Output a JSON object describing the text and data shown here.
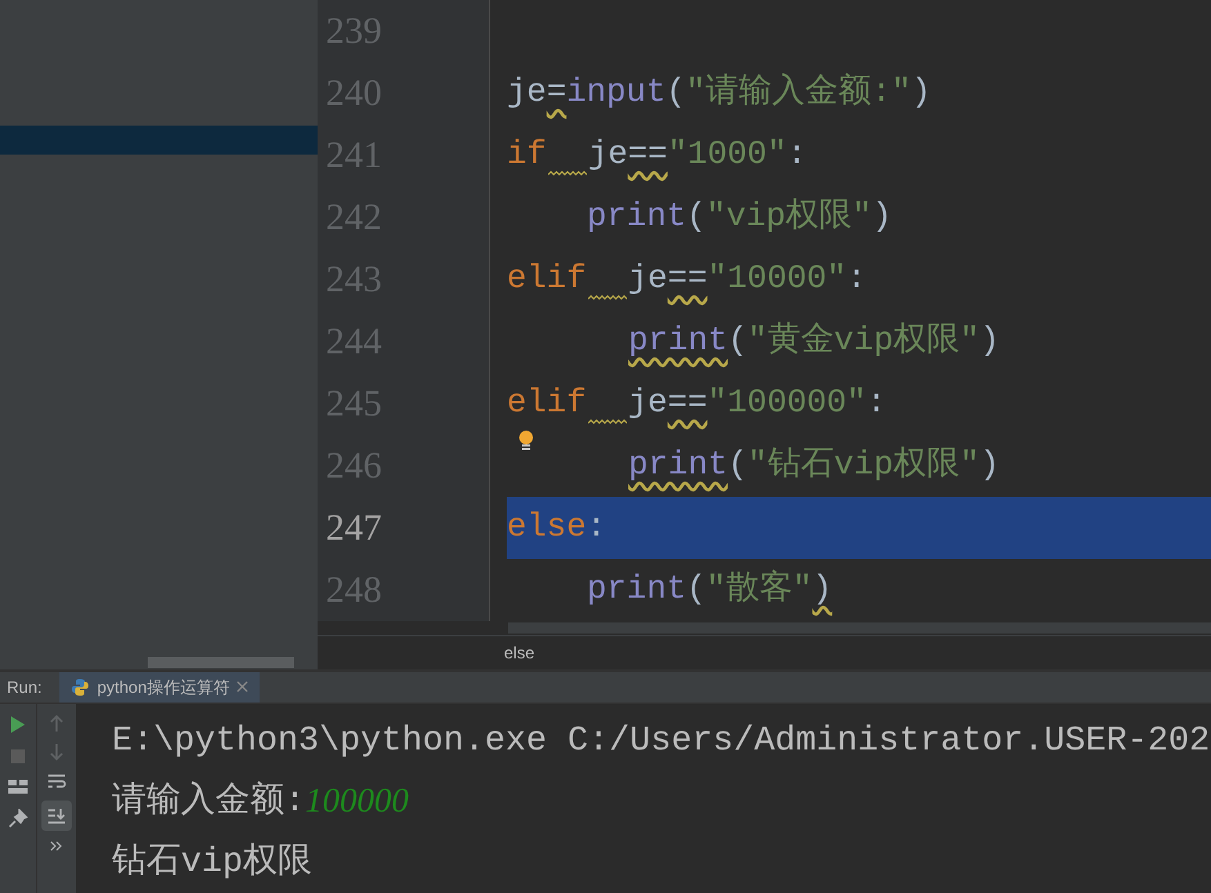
{
  "editor": {
    "lines": [
      {
        "number": "239",
        "kind": "statement",
        "selected": false,
        "bulb": false
      },
      {
        "number": "240",
        "kind": "statement",
        "selected": false,
        "bulb": false,
        "tokens": [
          {
            "kind": "plain",
            "text": "je",
            "warn": false,
            "gap_warn": false
          },
          {
            "kind": "plain",
            "text": "=",
            "warn": true,
            "gap_warn": false
          },
          {
            "kind": "builtin",
            "text": "input",
            "warn": false,
            "gap_warn": false
          },
          {
            "kind": "plain",
            "text": "(",
            "warn": false,
            "gap_warn": false
          },
          {
            "kind": "string",
            "text": "\"请输入金额:\"",
            "warn": false,
            "gap_warn": false
          },
          {
            "kind": "plain",
            "text": ")",
            "warn": false,
            "gap_warn": false
          }
        ]
      },
      {
        "number": "241",
        "kind": "statement",
        "selected": false,
        "bulb": false,
        "tokens": [
          {
            "kind": "keyword",
            "text": "if",
            "warn": false,
            "gap_warn": true
          },
          {
            "kind": "plain",
            "text": "je",
            "warn": false,
            "gap_warn": false
          },
          {
            "kind": "plain",
            "text": "==",
            "warn": true,
            "gap_warn": false
          },
          {
            "kind": "string",
            "text": "\"1000\"",
            "warn": false,
            "gap_warn": false
          },
          {
            "kind": "plain",
            "text": ":",
            "warn": false,
            "gap_warn": false
          }
        ]
      },
      {
        "number": "242",
        "kind": "block",
        "selected": false,
        "bulb": false,
        "tokens": [
          {
            "kind": "builtin",
            "text": "print",
            "warn": false,
            "gap_warn": false
          },
          {
            "kind": "plain",
            "text": "(",
            "warn": false,
            "gap_warn": false
          },
          {
            "kind": "string",
            "text": "\"vip权限\"",
            "warn": false,
            "gap_warn": false
          },
          {
            "kind": "plain",
            "text": ")",
            "warn": false,
            "gap_warn": false
          }
        ]
      },
      {
        "number": "243",
        "kind": "statement",
        "selected": false,
        "bulb": false,
        "tokens": [
          {
            "kind": "keyword",
            "text": "elif",
            "warn": false,
            "gap_warn": true
          },
          {
            "kind": "plain",
            "text": "je",
            "warn": false,
            "gap_warn": false
          },
          {
            "kind": "plain",
            "text": "==",
            "warn": true,
            "gap_warn": false
          },
          {
            "kind": "string",
            "text": "\"10000\"",
            "warn": false,
            "gap_warn": false
          },
          {
            "kind": "plain",
            "text": ":",
            "warn": false,
            "gap_warn": false
          }
        ]
      },
      {
        "number": "244",
        "kind": "deep-block",
        "selected": false,
        "bulb": false,
        "tokens": [
          {
            "kind": "builtin",
            "text": "print",
            "warn": true,
            "gap_warn": false
          },
          {
            "kind": "plain",
            "text": "(",
            "warn": false,
            "gap_warn": false
          },
          {
            "kind": "string",
            "text": "\"黄金vip权限\"",
            "warn": false,
            "gap_warn": false
          },
          {
            "kind": "plain",
            "text": ")",
            "warn": false,
            "gap_warn": false
          }
        ]
      },
      {
        "number": "245",
        "kind": "statement",
        "selected": false,
        "bulb": false,
        "tokens": [
          {
            "kind": "keyword",
            "text": "elif",
            "warn": false,
            "gap_warn": true
          },
          {
            "kind": "plain",
            "text": "je",
            "warn": false,
            "gap_warn": false
          },
          {
            "kind": "plain",
            "text": "==",
            "warn": true,
            "gap_warn": false
          },
          {
            "kind": "string",
            "text": "\"100000\"",
            "warn": false,
            "gap_warn": false
          },
          {
            "kind": "plain",
            "text": ":",
            "warn": false,
            "gap_warn": false
          }
        ]
      },
      {
        "number": "246",
        "kind": "deep-block",
        "selected": false,
        "bulb": true,
        "tokens": [
          {
            "kind": "builtin",
            "text": "print",
            "warn": true,
            "gap_warn": false
          },
          {
            "kind": "plain",
            "text": "(",
            "warn": false,
            "gap_warn": false
          },
          {
            "kind": "string",
            "text": "\"钻石vip权限\"",
            "warn": false,
            "gap_warn": false
          },
          {
            "kind": "plain",
            "text": ")",
            "warn": false,
            "gap_warn": false
          }
        ]
      },
      {
        "number": "247",
        "kind": "statement",
        "selected": true,
        "bulb": false,
        "tokens": [
          {
            "kind": "keyword",
            "text": "else",
            "warn": false,
            "gap_warn": false
          },
          {
            "kind": "plain",
            "text": ":",
            "warn": false,
            "gap_warn": false
          }
        ]
      },
      {
        "number": "248",
        "kind": "block",
        "selected": false,
        "bulb": false,
        "tokens": [
          {
            "kind": "builtin",
            "text": "print",
            "warn": false,
            "gap_warn": false
          },
          {
            "kind": "plain",
            "text": "(",
            "warn": false,
            "gap_warn": false
          },
          {
            "kind": "string",
            "text": "\"散客\"",
            "warn": false,
            "gap_warn": false
          },
          {
            "kind": "plain",
            "text": ")",
            "warn": true,
            "gap_warn": false
          }
        ]
      }
    ],
    "breadcrumb": "else"
  },
  "run": {
    "label": "Run:",
    "tab": "python操作运算符",
    "console": [
      {
        "kind": "output",
        "text": "E:\\python3\\python.exe C:/Users/Administrator.USER-202"
      },
      {
        "kind": "prompt",
        "text": "请输入金额:",
        "input": "100000"
      },
      {
        "kind": "output",
        "text": "钻石vip权限"
      }
    ]
  }
}
